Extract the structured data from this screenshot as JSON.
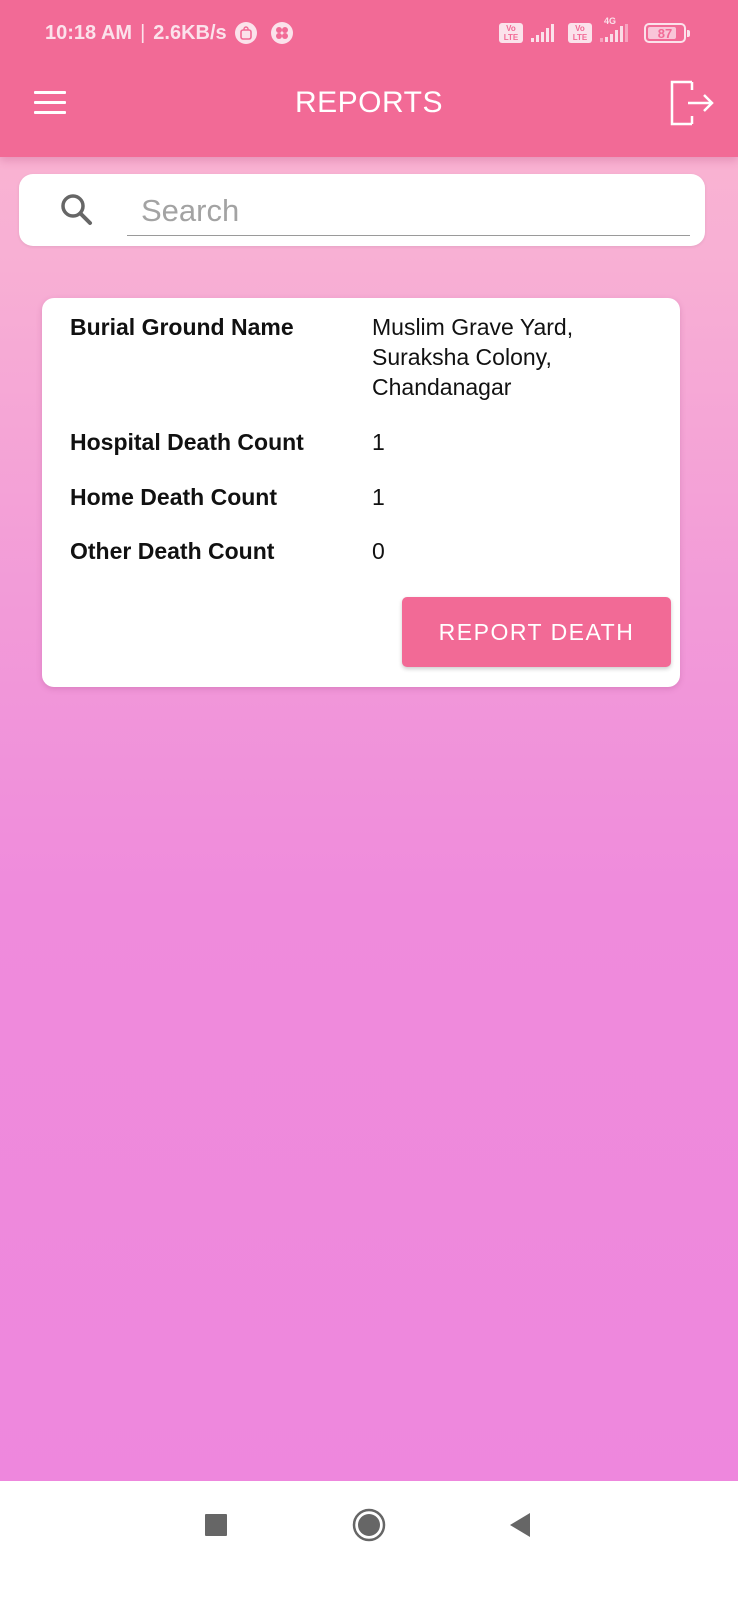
{
  "status_bar": {
    "time": "10:18 AM",
    "separator": "|",
    "net_speed": "2.6KB/s",
    "battery_level": "87",
    "sim1_badge": [
      "Vo",
      "LTE"
    ],
    "sim2_badge": [
      "Vo",
      "LTE"
    ],
    "network_type": "4G",
    "icons": [
      "jio-bag-icon",
      "app-flower-icon",
      "volte-icon",
      "signal-icon",
      "volte-icon",
      "signal-4g-icon",
      "battery-icon"
    ]
  },
  "app_bar": {
    "title": "REPORTS",
    "left_icon": "hamburger-menu-icon",
    "right_icon": "logout-icon"
  },
  "search": {
    "placeholder": "Search",
    "value": ""
  },
  "report_card": {
    "rows": [
      {
        "label": "Burial Ground Name",
        "value_lines": [
          "Muslim Grave Yard,",
          "Suraksha Colony,",
          "Chandanagar"
        ]
      },
      {
        "label": "Hospital Death Count",
        "value": "1"
      },
      {
        "label": "Home Death Count",
        "value": "1"
      },
      {
        "label": "Other Death Count",
        "value": "0"
      }
    ],
    "action_label": "REPORT DEATH"
  },
  "nav_bar": {
    "buttons": [
      "recents",
      "home",
      "back"
    ]
  },
  "colors": {
    "primary": "#f26a96",
    "background_top": "#fbb6cf",
    "background_bottom": "#ee87dd"
  }
}
